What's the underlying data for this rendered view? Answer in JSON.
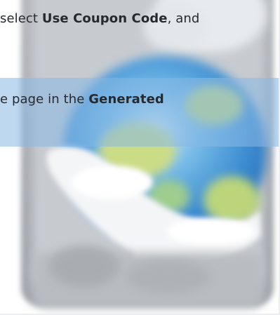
{
  "instructions": {
    "line1_prefix": "select ",
    "line1_bold": "Use Coupon Code",
    "line1_suffix": ", and",
    "line2_prefix": "e page in the ",
    "line2_bold": "Generated"
  },
  "illustration": {
    "icon_name": "globe-app-icon",
    "colors": {
      "frame": "#a9acb2",
      "panel": "#cfd3d8",
      "globe_blue": "#5fa7e0",
      "globe_green": "#c8dc7a",
      "highlight": "#88b8e4"
    }
  }
}
